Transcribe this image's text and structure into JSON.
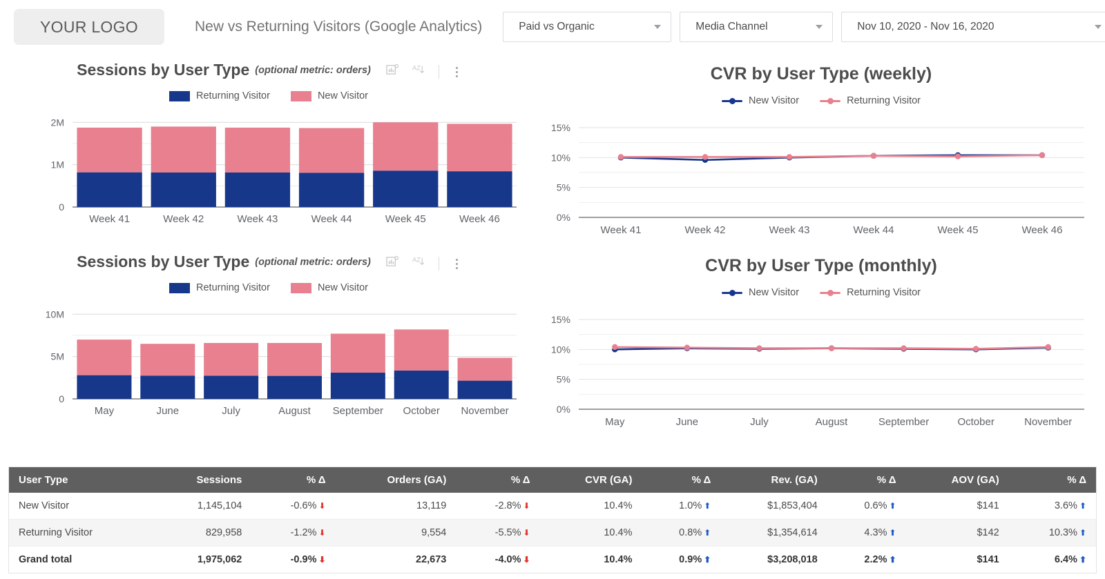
{
  "header": {
    "logo": "YOUR LOGO",
    "title": "New vs Returning Visitors (Google Analytics)",
    "filters": [
      {
        "name": "paid-vs-organic",
        "label": "Paid vs Organic"
      },
      {
        "name": "media-channel",
        "label": "Media Channel"
      },
      {
        "name": "date-range",
        "label": "Nov 10, 2020 - Nov 16, 2020"
      }
    ]
  },
  "colors": {
    "returning": "#17378a",
    "new": "#e8808f",
    "header_bg": "#5f5f5f",
    "up_arrow": "#1a56c4",
    "down_arrow": "#e0332a"
  },
  "panels": {
    "weekly_bar": {
      "title": "Sessions by User Type",
      "subtitle": "(optional metric: orders)",
      "icons": [
        "optional-metric-icon",
        "sort-az-icon",
        "more-options-icon"
      ]
    },
    "monthly_bar": {
      "title": "Sessions by User Type",
      "subtitle": "(optional metric: orders)",
      "icons": [
        "optional-metric-icon",
        "sort-az-icon",
        "more-options-icon"
      ]
    },
    "weekly_cvr": {
      "title": "CVR by User Type (weekly)"
    },
    "monthly_cvr": {
      "title": "CVR by User Type (monthly)"
    }
  },
  "chart_data": [
    {
      "id": "sessions-weekly",
      "type": "bar",
      "stacked": true,
      "title": "Sessions by User Type",
      "subtitle": "(optional metric: orders)",
      "categories": [
        "Week 41",
        "Week 42",
        "Week 43",
        "Week 44",
        "Week 45",
        "Week 46"
      ],
      "series": [
        {
          "name": "Returning Visitor",
          "color": "#17378a",
          "values": [
            820000,
            815000,
            815000,
            810000,
            860000,
            845000
          ]
        },
        {
          "name": "New Visitor",
          "color": "#e8808f",
          "values": [
            1055000,
            1085000,
            1060000,
            1055000,
            1140000,
            1120000
          ]
        }
      ],
      "xlabel": "",
      "ylabel": "",
      "ylim": [
        0,
        2200000
      ],
      "yticks": [
        0,
        1000000,
        2000000
      ],
      "ytick_labels": [
        "0",
        "1M",
        "2M"
      ],
      "grid": true,
      "legend_position": "top"
    },
    {
      "id": "cvr-weekly",
      "type": "line",
      "title": "CVR by User Type (weekly)",
      "categories": [
        "Week 41",
        "Week 42",
        "Week 43",
        "Week 44",
        "Week 45",
        "Week 46"
      ],
      "series": [
        {
          "name": "New Visitor",
          "color": "#17378a",
          "values": [
            10.0,
            9.6,
            10.0,
            10.3,
            10.4,
            10.4
          ]
        },
        {
          "name": "Returning Visitor",
          "color": "#e8808f",
          "values": [
            10.1,
            10.1,
            10.1,
            10.3,
            10.2,
            10.4
          ]
        }
      ],
      "xlabel": "",
      "ylabel": "",
      "ylim": [
        0,
        16.5
      ],
      "yticks": [
        0,
        5,
        10,
        15
      ],
      "ytick_labels": [
        "0%",
        "5%",
        "10%",
        "15%"
      ],
      "grid": true,
      "legend_position": "top"
    },
    {
      "id": "sessions-monthly",
      "type": "bar",
      "stacked": true,
      "title": "Sessions by User Type",
      "subtitle": "(optional metric: orders)",
      "categories": [
        "May",
        "June",
        "July",
        "August",
        "September",
        "October",
        "November"
      ],
      "series": [
        {
          "name": "Returning Visitor",
          "color": "#17378a",
          "values": [
            2800000,
            2750000,
            2740000,
            2720000,
            3100000,
            3350000,
            2150000
          ]
        },
        {
          "name": "New Visitor",
          "color": "#e8808f",
          "values": [
            4200000,
            3750000,
            3860000,
            3880000,
            4600000,
            4850000,
            2700000
          ]
        }
      ],
      "xlabel": "",
      "ylabel": "",
      "ylim": [
        0,
        11000000
      ],
      "yticks": [
        0,
        5000000,
        10000000
      ],
      "ytick_labels": [
        "0",
        "5M",
        "10M"
      ],
      "grid": true,
      "legend_position": "top"
    },
    {
      "id": "cvr-monthly",
      "type": "line",
      "title": "CVR by User Type (monthly)",
      "categories": [
        "May",
        "June",
        "July",
        "August",
        "September",
        "October",
        "November"
      ],
      "series": [
        {
          "name": "New Visitor",
          "color": "#17378a",
          "values": [
            10.0,
            10.2,
            10.1,
            10.2,
            10.1,
            10.0,
            10.3
          ]
        },
        {
          "name": "Returning Visitor",
          "color": "#e8808f",
          "values": [
            10.4,
            10.3,
            10.2,
            10.2,
            10.2,
            10.1,
            10.4
          ]
        }
      ],
      "xlabel": "",
      "ylabel": "",
      "ylim": [
        0,
        16.5
      ],
      "yticks": [
        0,
        5,
        10,
        15
      ],
      "ytick_labels": [
        "0%",
        "5%",
        "10%",
        "15%"
      ],
      "grid": true,
      "legend_position": "top"
    }
  ],
  "legend": {
    "bar": [
      {
        "label": "Returning Visitor",
        "color": "#17378a"
      },
      {
        "label": "New Visitor",
        "color": "#e8808f"
      }
    ],
    "line": [
      {
        "label": "New Visitor",
        "color": "#17378a"
      },
      {
        "label": "Returning Visitor",
        "color": "#e8808f"
      }
    ]
  },
  "table": {
    "columns": [
      "User Type",
      "Sessions",
      "% Δ",
      "Orders (GA)",
      "% Δ",
      "CVR (GA)",
      "% Δ",
      "Rev. (GA)",
      "% Δ",
      "AOV (GA)",
      "% Δ"
    ],
    "rows": [
      {
        "user_type": "New Visitor",
        "sessions": "1,145,104",
        "sessions_delta": "-0.6%",
        "sessions_dir": "down",
        "orders": "13,119",
        "orders_delta": "-2.8%",
        "orders_dir": "down",
        "cvr": "10.4%",
        "cvr_delta": "1.0%",
        "cvr_dir": "up",
        "rev": "$1,853,404",
        "rev_delta": "0.6%",
        "rev_dir": "up",
        "aov": "$141",
        "aov_delta": "3.6%",
        "aov_dir": "up"
      },
      {
        "user_type": "Returning Visitor",
        "sessions": "829,958",
        "sessions_delta": "-1.2%",
        "sessions_dir": "down",
        "orders": "9,554",
        "orders_delta": "-5.5%",
        "orders_dir": "down",
        "cvr": "10.4%",
        "cvr_delta": "0.8%",
        "cvr_dir": "up",
        "rev": "$1,354,614",
        "rev_delta": "4.3%",
        "rev_dir": "up",
        "aov": "$142",
        "aov_delta": "10.3%",
        "aov_dir": "up"
      },
      {
        "user_type": "Grand total",
        "sessions": "1,975,062",
        "sessions_delta": "-0.9%",
        "sessions_dir": "down",
        "orders": "22,673",
        "orders_delta": "-4.0%",
        "orders_dir": "down",
        "cvr": "10.4%",
        "cvr_delta": "0.9%",
        "cvr_dir": "up",
        "rev": "$3,208,018",
        "rev_delta": "2.2%",
        "rev_dir": "up",
        "aov": "$141",
        "aov_delta": "6.4%",
        "aov_dir": "up"
      }
    ]
  }
}
